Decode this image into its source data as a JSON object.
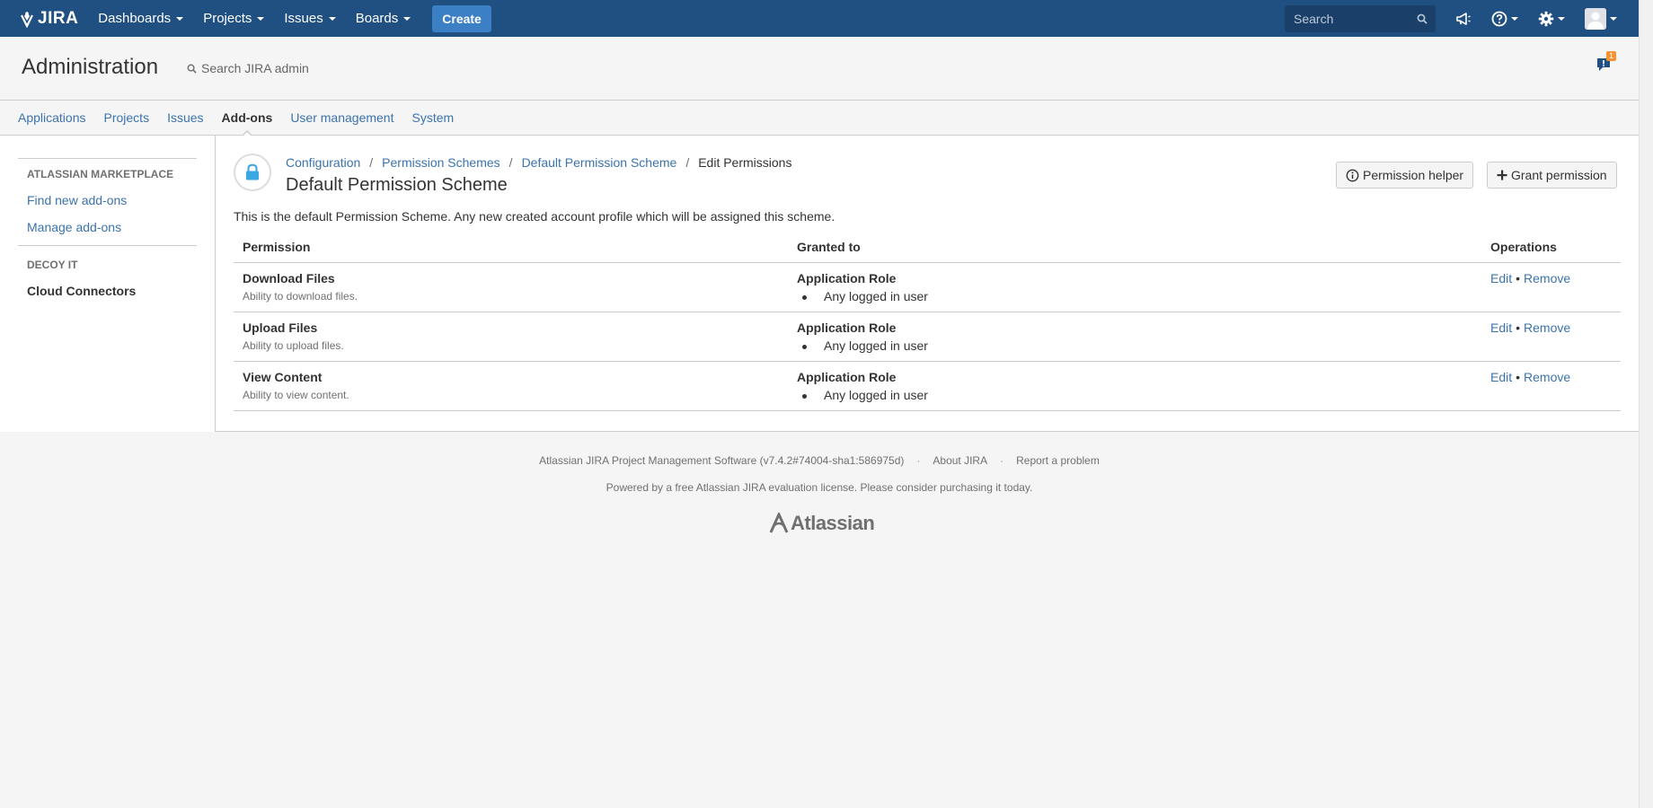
{
  "topnav": {
    "logo_text": "JIRA",
    "items": [
      {
        "label": "Dashboards"
      },
      {
        "label": "Projects"
      },
      {
        "label": "Issues"
      },
      {
        "label": "Boards"
      }
    ],
    "create_label": "Create",
    "search_placeholder": "Search",
    "brand_color": "#205081"
  },
  "admin": {
    "title": "Administration",
    "search_placeholder": "Search JIRA admin",
    "notification_count": "1",
    "tabs": [
      {
        "label": "Applications"
      },
      {
        "label": "Projects"
      },
      {
        "label": "Issues"
      },
      {
        "label": "Add-ons",
        "active": true
      },
      {
        "label": "User management"
      },
      {
        "label": "System"
      }
    ]
  },
  "sidebar": {
    "sections": [
      {
        "heading": "ATLASSIAN MARKETPLACE",
        "items": [
          {
            "label": "Find new add-ons"
          },
          {
            "label": "Manage add-ons"
          }
        ]
      },
      {
        "heading": "DECOY IT",
        "items": [
          {
            "label": "Cloud Connectors",
            "active": true
          }
        ]
      }
    ]
  },
  "main": {
    "breadcrumb": [
      {
        "label": "Configuration"
      },
      {
        "label": "Permission Schemes"
      },
      {
        "label": "Default Permission Scheme"
      },
      {
        "label": "Edit Permissions"
      }
    ],
    "title": "Default Permission Scheme",
    "permission_helper_label": "Permission helper",
    "grant_permission_label": "Grant permission",
    "description": "This is the default Permission Scheme. Any new created account profile which will be assigned this scheme.",
    "table": {
      "headers": {
        "permission": "Permission",
        "granted_to": "Granted to",
        "operations": "Operations"
      },
      "rows": [
        {
          "name": "Download Files",
          "desc": "Ability to download files.",
          "grant_type": "Application Role",
          "grant_item": "Any logged in user",
          "edit": "Edit",
          "remove": "Remove"
        },
        {
          "name": "Upload Files",
          "desc": "Ability to upload files.",
          "grant_type": "Application Role",
          "grant_item": "Any logged in user",
          "edit": "Edit",
          "remove": "Remove"
        },
        {
          "name": "View Content",
          "desc": "Ability to view content.",
          "grant_type": "Application Role",
          "grant_item": "Any logged in user",
          "edit": "Edit",
          "remove": "Remove"
        }
      ]
    }
  },
  "footer": {
    "version": "Atlassian JIRA Project Management Software (v7.4.2#74004-sha1:586975d)",
    "about": "About JIRA",
    "report": "Report a problem",
    "license": "Powered by a free Atlassian JIRA evaluation license. Please consider purchasing it today.",
    "logo_text": "Atlassian"
  }
}
